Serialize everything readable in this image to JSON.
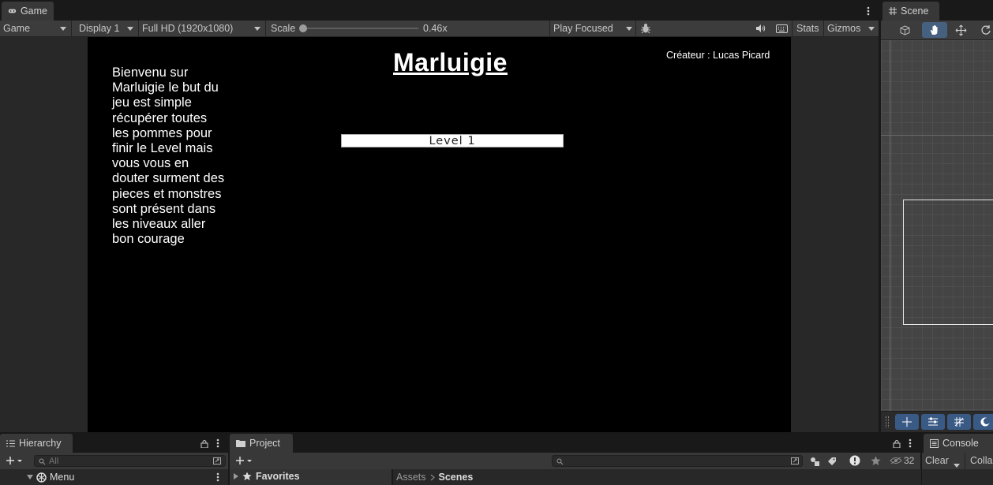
{
  "game_tab": {
    "label": "Game",
    "icon": "gamepad-icon"
  },
  "scene_tab": {
    "label": "Scene",
    "icon": "grid-icon"
  },
  "game_toolbar": {
    "mode": "Game",
    "display": "Display 1",
    "resolution": "Full HD (1920x1080)",
    "scale_label": "Scale",
    "scale_value": "0.46x",
    "scale_fraction": 0.0,
    "play_mode": "Play Focused",
    "stats": "Stats",
    "gizmos": "Gizmos"
  },
  "game_view": {
    "title": "Marluigie",
    "creator": "Créateur : Lucas Picard",
    "intro_lines": [
      "Bienvenu sur",
      "Marluigie le but du",
      "jeu est simple",
      "récupérer toutes",
      "les pommes pour",
      "finir le Level mais",
      "vous vous en",
      "douter surment des",
      "pieces et monstres",
      "sont présent dans",
      "les niveaux aller",
      "bon courage"
    ],
    "level_button": "Level 1"
  },
  "hierarchy": {
    "tab_label": "Hierarchy",
    "search_placeholder": "All",
    "scene_name": "Menu"
  },
  "project": {
    "tab_label": "Project",
    "favorites": "Favorites",
    "breadcrumb": [
      "Assets",
      "Scenes"
    ],
    "hidden_count": "32"
  },
  "console": {
    "tab_label": "Console",
    "clear": "Clear",
    "collapse": "Colla"
  },
  "colors": {
    "game_bg": "#000000",
    "editor_bg": "#282828",
    "scene_bg": "#444444",
    "accent": "#3a5a86"
  }
}
